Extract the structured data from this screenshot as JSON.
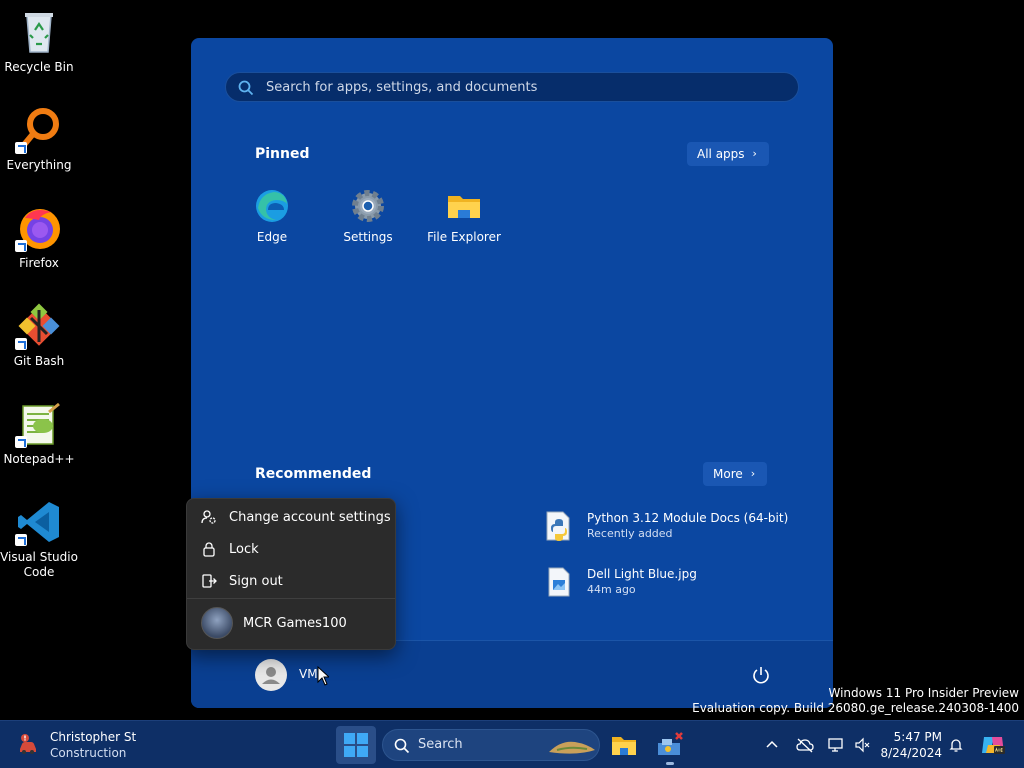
{
  "desktop": {
    "icons": [
      {
        "label": "Recycle Bin"
      },
      {
        "label": "Everything"
      },
      {
        "label": "Firefox"
      },
      {
        "label": "Git Bash"
      },
      {
        "label": "Notepad++"
      },
      {
        "label": "Visual Studio Code"
      }
    ]
  },
  "start_menu": {
    "search_placeholder": "Search for apps, settings, and documents",
    "pinned_title": "Pinned",
    "all_apps_label": "All apps",
    "pinned_apps": [
      {
        "label": "Edge",
        "icon": "edge-icon"
      },
      {
        "label": "Settings",
        "icon": "gear-icon"
      },
      {
        "label": "File Explorer",
        "icon": "folder-icon"
      }
    ],
    "recommended_title": "Recommended",
    "more_label": "More",
    "recommended": [
      {
        "name": "Python 3.12 Module Docs (64-bit)",
        "sub": "Recently added",
        "icon": "python-icon"
      },
      {
        "name": "Dell Light Blue.jpg",
        "sub": "44m ago",
        "icon": "image-file-icon"
      }
    ],
    "user_name": "VM",
    "accent_color": "#0b47a1"
  },
  "account_flyout": {
    "items": [
      {
        "label": "Change account settings",
        "icon": "account-settings-icon"
      },
      {
        "label": "Lock",
        "icon": "lock-icon"
      },
      {
        "label": "Sign out",
        "icon": "sign-out-icon"
      }
    ],
    "other_user": "MCR Games100"
  },
  "watermark": {
    "line1": "Windows 11 Pro Insider Preview",
    "line2": "Evaluation copy. Build 26080.ge_release.240308-1400"
  },
  "taskbar": {
    "weather_title": "Christopher St",
    "weather_sub": "Construction",
    "search_label": "Search",
    "time": "5:47 PM",
    "date": "8/24/2024"
  }
}
